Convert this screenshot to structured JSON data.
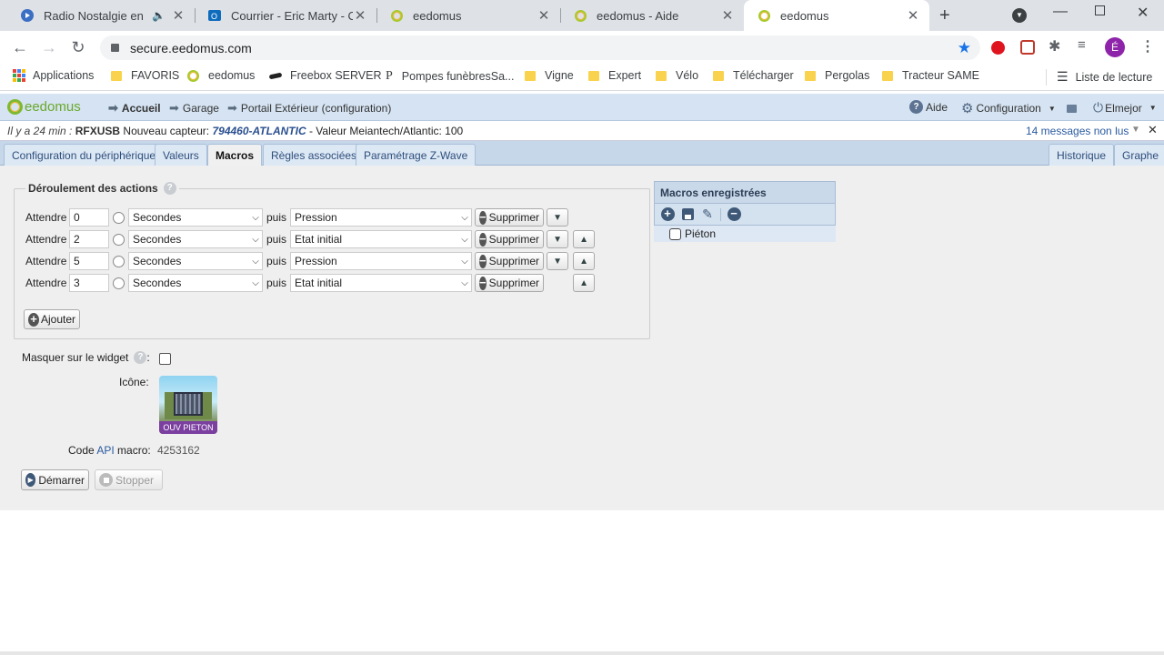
{
  "browser": {
    "tabs": [
      {
        "title": "Radio Nostalgie en direct",
        "icon": "radio-icon"
      },
      {
        "title": "Courrier - Eric Marty - Outlook",
        "icon": "outlook-icon"
      },
      {
        "title": "eedomus",
        "icon": "eedomus-icon"
      },
      {
        "title": "eedomus - Aide",
        "icon": "eedomus-icon"
      },
      {
        "title": "eedomus",
        "icon": "eedomus-icon"
      }
    ],
    "url": "secure.eedomus.com",
    "profile_initial": "É",
    "bookmarks": [
      {
        "label": "Applications",
        "icon": "apps-grid-icon"
      },
      {
        "label": "FAVORIS",
        "icon": "folder-icon"
      },
      {
        "label": "eedomus",
        "icon": "eedomus-icon"
      },
      {
        "label": "Freebox SERVER",
        "icon": "freebox-icon"
      },
      {
        "label": "Pompes funèbresSa...",
        "icon": "p-icon"
      },
      {
        "label": "Vigne",
        "icon": "folder-icon"
      },
      {
        "label": "Expert",
        "icon": "folder-icon"
      },
      {
        "label": "Vélo",
        "icon": "folder-icon"
      },
      {
        "label": "Télécharger",
        "icon": "folder-icon"
      },
      {
        "label": "Pergolas",
        "icon": "folder-icon"
      },
      {
        "label": "Tracteur SAME",
        "icon": "folder-icon"
      }
    ],
    "reading_list": "Liste de lecture"
  },
  "app": {
    "logo": "eedomus",
    "breadcrumb": [
      "Accueil",
      "Garage",
      "Portail Extérieur (configuration)"
    ],
    "help": "Aide",
    "config": "Configuration",
    "user": "Elmejor"
  },
  "message": {
    "time": "Il y a 24 min :",
    "device": "RFXUSB",
    "text1": "Nouveau capteur:",
    "sensor": "794460-ATLANTIC",
    "text2": "- Valeur Meiantech/Atlantic: 100",
    "unread": "14 messages non lus"
  },
  "subtabs": [
    "Configuration du périphérique",
    "Valeurs",
    "Macros",
    "Règles associées",
    "Paramétrage Z-Wave"
  ],
  "subtabs_right": [
    "Historique",
    "Graphe"
  ],
  "actions": {
    "legend": "Déroulement des actions",
    "wait_label": "Attendre",
    "then_label": "puis",
    "delete_label": "Supprimer",
    "add_label": "Ajouter",
    "rows": [
      {
        "wait": "0",
        "unit": "Secondes",
        "action": "Pression"
      },
      {
        "wait": "2",
        "unit": "Secondes",
        "action": "Etat initial"
      },
      {
        "wait": "5",
        "unit": "Secondes",
        "action": "Pression"
      },
      {
        "wait": "3",
        "unit": "Secondes",
        "action": "Etat initial"
      }
    ]
  },
  "widget": {
    "hide_label": "Masquer sur le widget",
    "icon_label": "Icône:",
    "icon_caption": "OUV PIETON",
    "code_label_pre": "Code",
    "code_label_api": "API",
    "code_label_post": "macro:",
    "code_value": "4253162",
    "start": "Démarrer",
    "stop": "Stopper"
  },
  "saved_macros": {
    "title": "Macros enregistrées",
    "items": [
      "Piéton"
    ]
  }
}
